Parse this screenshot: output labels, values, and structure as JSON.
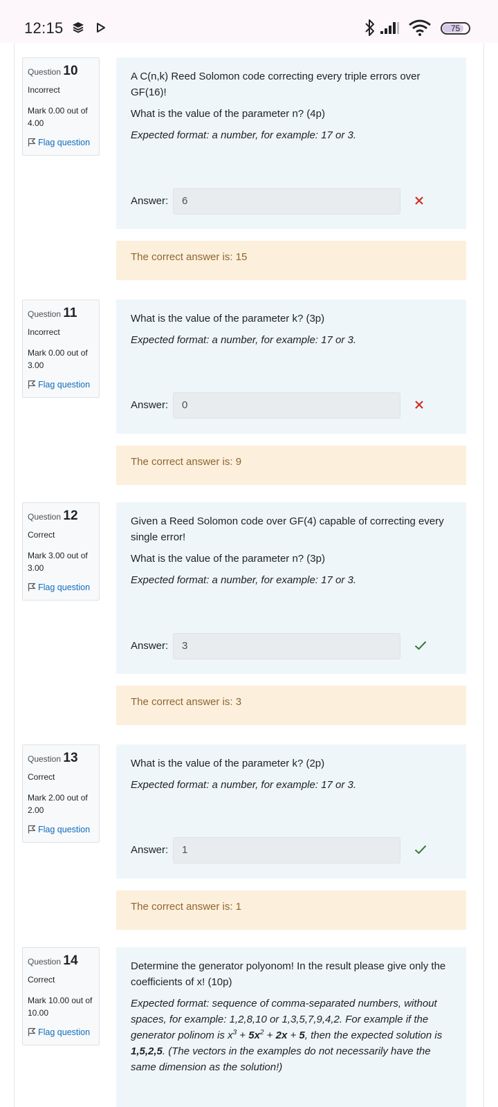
{
  "status_bar": {
    "time": "12:15",
    "battery": "75",
    "icons": [
      "stacked-notification-icon",
      "play-icon",
      "bluetooth-icon",
      "signal-icon",
      "wifi-icon",
      "battery-icon"
    ]
  },
  "colors": {
    "question_bg": "#eef6fa",
    "feedback_bg": "#fcefdc",
    "feedback_text": "#8e662e",
    "link": "#0f6cbf",
    "incorrect": "#ca3120",
    "correct": "#357a32"
  },
  "labels": {
    "question": "Question",
    "flag": "Flag question",
    "answer": "Answer:",
    "format_prefix": "Expected format: a number, for example: 17 or 3."
  },
  "questions": [
    {
      "number": "10",
      "state": "Incorrect",
      "grade": "Mark 0.00 out of 4.00",
      "text": "A C(n,k) Reed Solomon code correcting every triple errors over GF(16)!",
      "prompt": "What is the value of the parameter n? (4p)",
      "format": "Expected format: a number, for example: 17 or 3.",
      "answer": "6",
      "result": "incorrect",
      "feedback": "The correct answer is: 15"
    },
    {
      "number": "11",
      "state": "Incorrect",
      "grade": "Mark 0.00 out of 3.00",
      "prompt": "What is the value of the parameter k? (3p)",
      "format": "Expected format: a number, for example: 17 or 3.",
      "answer": "0",
      "result": "incorrect",
      "feedback": "The correct answer is: 9"
    },
    {
      "number": "12",
      "state": "Correct",
      "grade": "Mark 3.00 out of 3.00",
      "text": "Given a Reed Solomon code over GF(4) capable of correcting every single error!",
      "prompt": "What is the value of the parameter n? (3p)",
      "format": "Expected format: a number, for example: 17 or 3.",
      "answer": "3",
      "result": "correct",
      "feedback": "The correct answer is: 3"
    },
    {
      "number": "13",
      "state": "Correct",
      "grade": "Mark 2.00 out of 2.00",
      "prompt": "What is the value of the parameter k? (2p)",
      "format": "Expected format: a number, for example: 17 or 3.",
      "answer": "1",
      "result": "correct",
      "feedback": "The correct answer is: 1"
    },
    {
      "number": "14",
      "state": "Correct",
      "grade": "Mark 10.00 out of 10.00",
      "text": "Determine the generator polyonom! In the result please give only the coefficients of x! (10p)",
      "format_parts": {
        "a": "Expected format: sequence of comma-separated numbers, without spaces, for example: 1,2,8,10 or 1,3,5,7,9,4,2. For example if the generator polinom is x",
        "exp3": "3",
        "b": " + ",
        "c5x": "5x",
        "exp2": "2",
        "d": " + ",
        "e2x": "2x",
        "f": " + ",
        "g5": "5",
        "h": ", then the expected solution is ",
        "sol": "1,5,2,5",
        "i": ". (The vectors in the examples do not necessarily have the same dimension as the solution!)"
      }
    }
  ]
}
